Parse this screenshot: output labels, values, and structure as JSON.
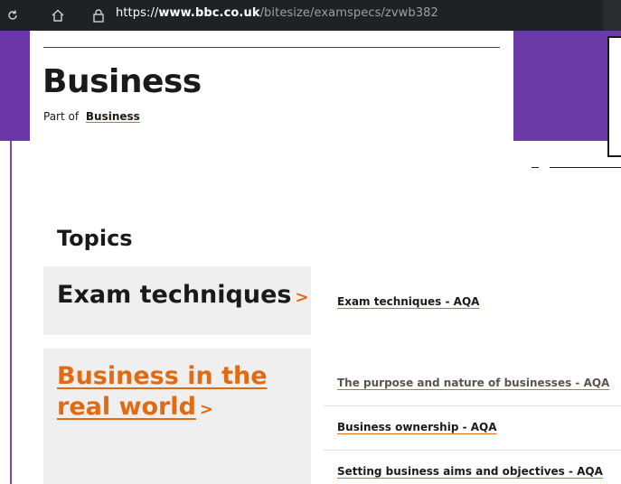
{
  "browser": {
    "url_prefix": "https://",
    "url_host": "www.bbc.co.uk",
    "url_path": "/bitesize/examspecs/zvwb382"
  },
  "header": {
    "title": "Business",
    "part_of_label": "Part of",
    "part_of_link": "Business"
  },
  "topics": {
    "heading": "Topics",
    "items": [
      {
        "title": "Exam techniques",
        "chevron": ">"
      },
      {
        "title": "Business in the real world",
        "chevron": ">"
      }
    ]
  },
  "subtopics": [
    {
      "label": "Exam techniques - AQA"
    },
    {
      "label": "The purpose and nature of businesses - AQA"
    },
    {
      "label": "Business ownership - AQA"
    },
    {
      "label": "Setting business aims and objectives - AQA"
    }
  ],
  "colors": {
    "accent": "#e06b13",
    "purple": "#6b3aa6",
    "card_bg": "#efefef",
    "browser_bg": "#202124"
  }
}
